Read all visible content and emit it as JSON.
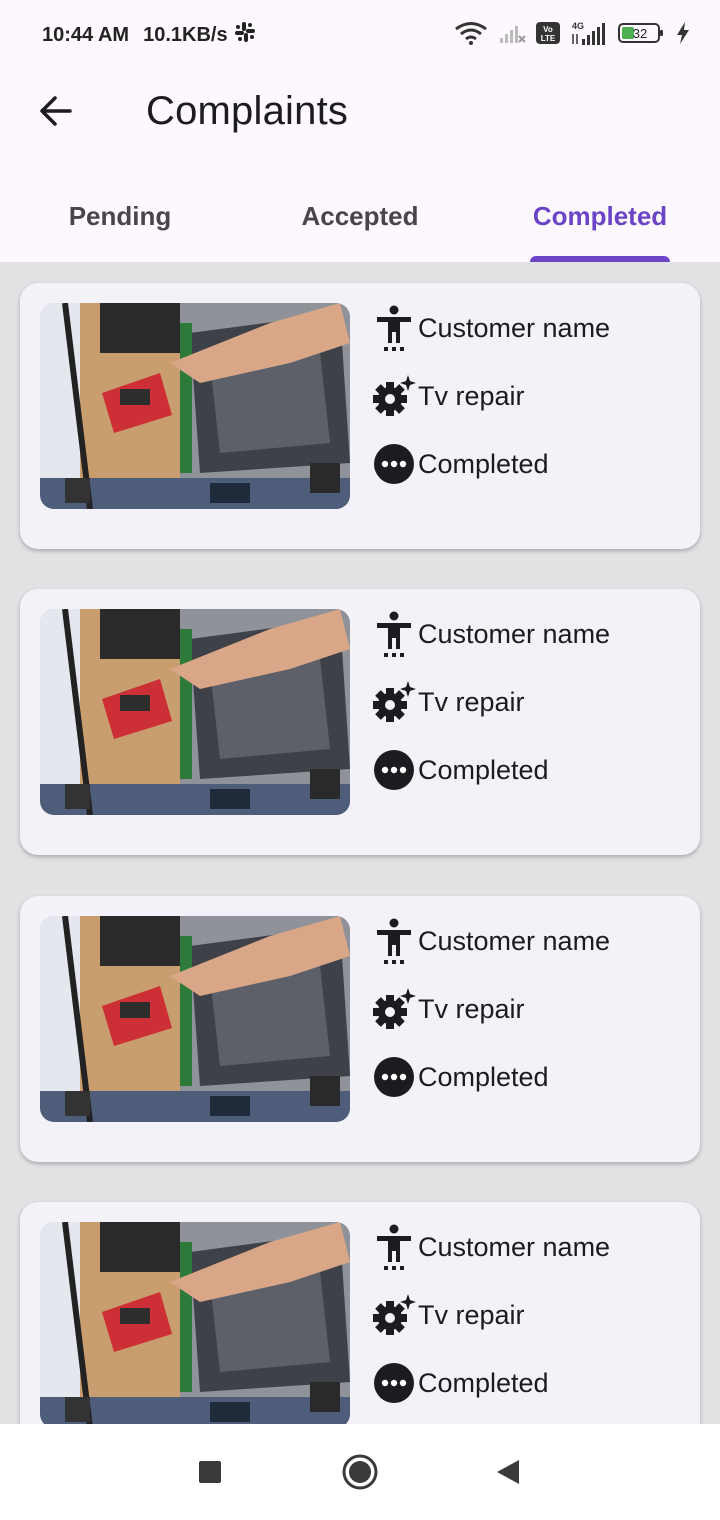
{
  "status": {
    "time": "10:44 AM",
    "speed": "10.1KB/s",
    "battery": "32",
    "network": "4G"
  },
  "appbar": {
    "title": "Complaints",
    "back_icon": "arrow-back-icon"
  },
  "tabs": [
    {
      "label": "Pending",
      "active": false
    },
    {
      "label": "Accepted",
      "active": false
    },
    {
      "label": "Completed",
      "active": true
    }
  ],
  "cards": [
    {
      "customer": "Customer name",
      "service": "Tv repair",
      "status": "Completed"
    },
    {
      "customer": "Customer name",
      "service": "Tv repair",
      "status": "Completed"
    },
    {
      "customer": "Customer name",
      "service": "Tv repair",
      "status": "Completed"
    },
    {
      "customer": "Customer name",
      "service": "Tv repair",
      "status": "Completed"
    }
  ],
  "colors": {
    "accent": "#6b45c6",
    "card_bg": "#f4f2f9",
    "list_bg": "#e2e2e4"
  },
  "navbar": {
    "recents_icon": "square-icon",
    "home_icon": "circle-icon",
    "back_icon": "triangle-back-icon"
  }
}
